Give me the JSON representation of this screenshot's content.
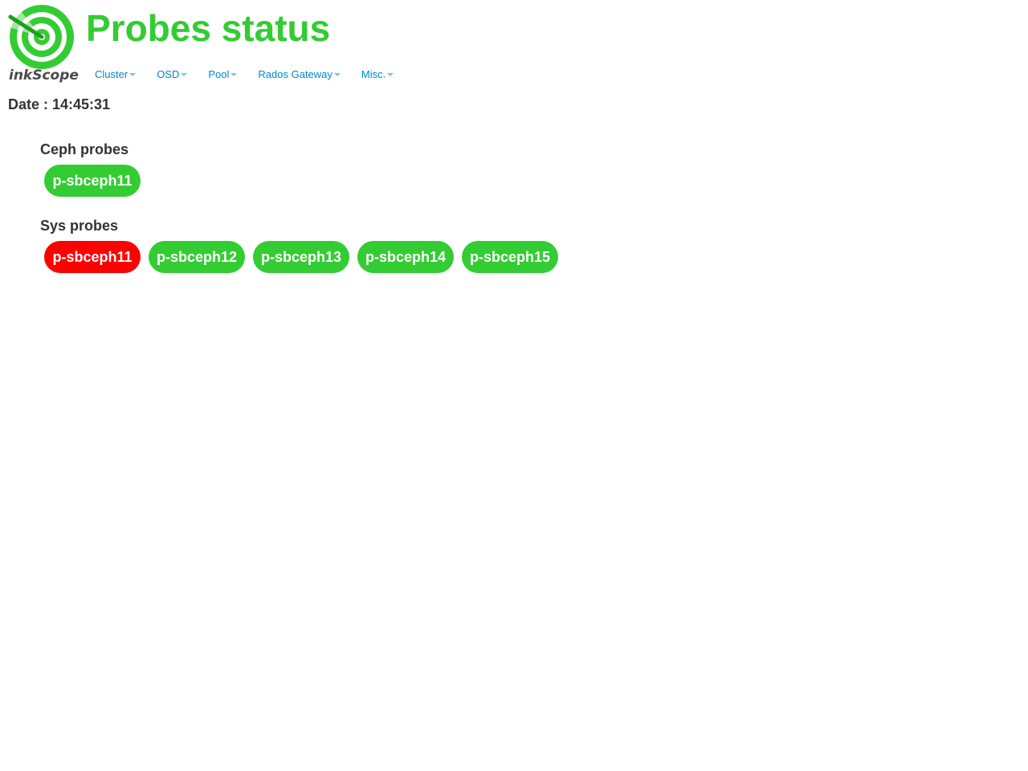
{
  "app": {
    "logo_text": "inkScope",
    "page_title": "Probes status"
  },
  "menu": {
    "items": [
      {
        "label": "Cluster"
      },
      {
        "label": "OSD"
      },
      {
        "label": "Pool"
      },
      {
        "label": "Rados Gateway"
      },
      {
        "label": "Misc."
      }
    ]
  },
  "date": {
    "text": "Date : 14:45:31"
  },
  "colors": {
    "brand_green": "#33cc33",
    "status_ok": "#33cc33",
    "status_error": "#ff0000",
    "menu_link": "#0088cc"
  },
  "ceph_probes": {
    "title": "Ceph probes",
    "items": [
      {
        "label": "p-sbceph11",
        "status": "ok"
      }
    ]
  },
  "sys_probes": {
    "title": "Sys probes",
    "items": [
      {
        "label": "p-sbceph11",
        "status": "error"
      },
      {
        "label": "p-sbceph12",
        "status": "ok"
      },
      {
        "label": "p-sbceph13",
        "status": "ok"
      },
      {
        "label": "p-sbceph14",
        "status": "ok"
      },
      {
        "label": "p-sbceph15",
        "status": "ok"
      }
    ]
  }
}
